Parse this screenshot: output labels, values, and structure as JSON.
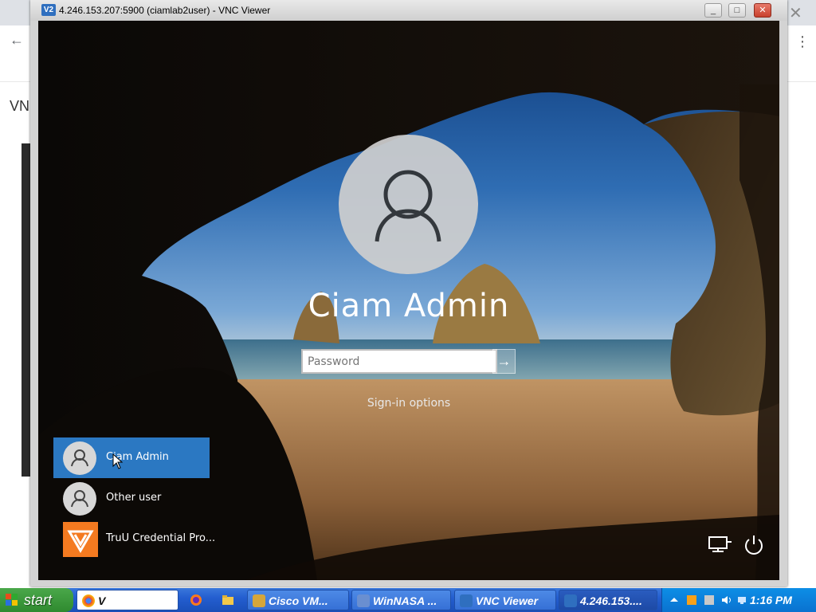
{
  "vnc_window": {
    "title": "4.246.153.207:5900 (ciamlab2user) - VNC Viewer",
    "app_icon": "V2",
    "minimize_label": "_",
    "maximize_label": "□",
    "close_label": "✕"
  },
  "host": {
    "back_glyph": "←",
    "page_text": "VN",
    "close_glyph": "✕",
    "menu_glyph": "⋮"
  },
  "lockscreen": {
    "username": "Ciam Admin",
    "password_placeholder": "Password",
    "submit_glyph": "→",
    "signin_options": "Sign-in options",
    "users": [
      {
        "label": "Ciam Admin",
        "selected": true,
        "icon": "user-icon"
      },
      {
        "label": "Other user",
        "selected": false,
        "icon": "user-icon"
      },
      {
        "label": "TruU Credential Pro...",
        "selected": false,
        "icon": "truu-logo-icon"
      }
    ],
    "network_icon": "network-icon",
    "power_icon": "power-icon"
  },
  "taskbar": {
    "start_label": "start",
    "tasks": [
      {
        "label": "V",
        "icon": "chrome-icon"
      },
      {
        "label": "Cisco VM...",
        "icon": "vm-icon"
      },
      {
        "label": "WinNASA ...",
        "icon": "winnasa-icon"
      },
      {
        "label": "VNC Viewer",
        "icon": "vnc-icon"
      },
      {
        "label": "4.246.153....",
        "icon": "vnc-icon"
      }
    ],
    "clock": "1:16 PM"
  },
  "colors": {
    "selected_user": "#2b78c2",
    "truu_orange": "#f47a20",
    "taskbar_blue": "#245ed0",
    "start_green": "#3a993a"
  }
}
